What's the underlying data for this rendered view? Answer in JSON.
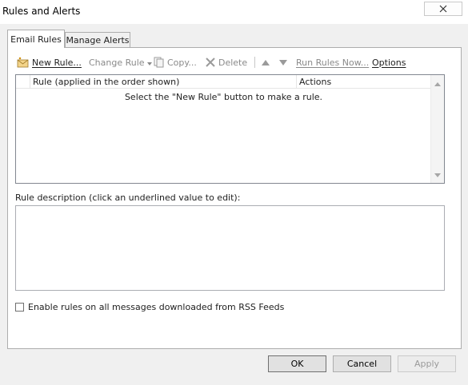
{
  "window": {
    "title": "Rules and Alerts"
  },
  "tabs": [
    {
      "label": "Email Rules",
      "active": true
    },
    {
      "label": "Manage Alerts",
      "active": false
    }
  ],
  "toolbar": {
    "new_rule": "New Rule...",
    "change_rule": "Change Rule",
    "copy": "Copy...",
    "delete": "Delete",
    "run_rules_now": "Run Rules Now...",
    "options": "Options"
  },
  "rules_list": {
    "columns": [
      "Rule (applied in the order shown)",
      "Actions"
    ],
    "empty_message": "Select the \"New Rule\" button to make a rule.",
    "rows": []
  },
  "description": {
    "label": "Rule description (click an underlined value to edit):",
    "text": ""
  },
  "rss_option": {
    "label": "Enable rules on all messages downloaded from RSS Feeds",
    "checked": false
  },
  "buttons": {
    "ok": "OK",
    "cancel": "Cancel",
    "apply": "Apply"
  }
}
